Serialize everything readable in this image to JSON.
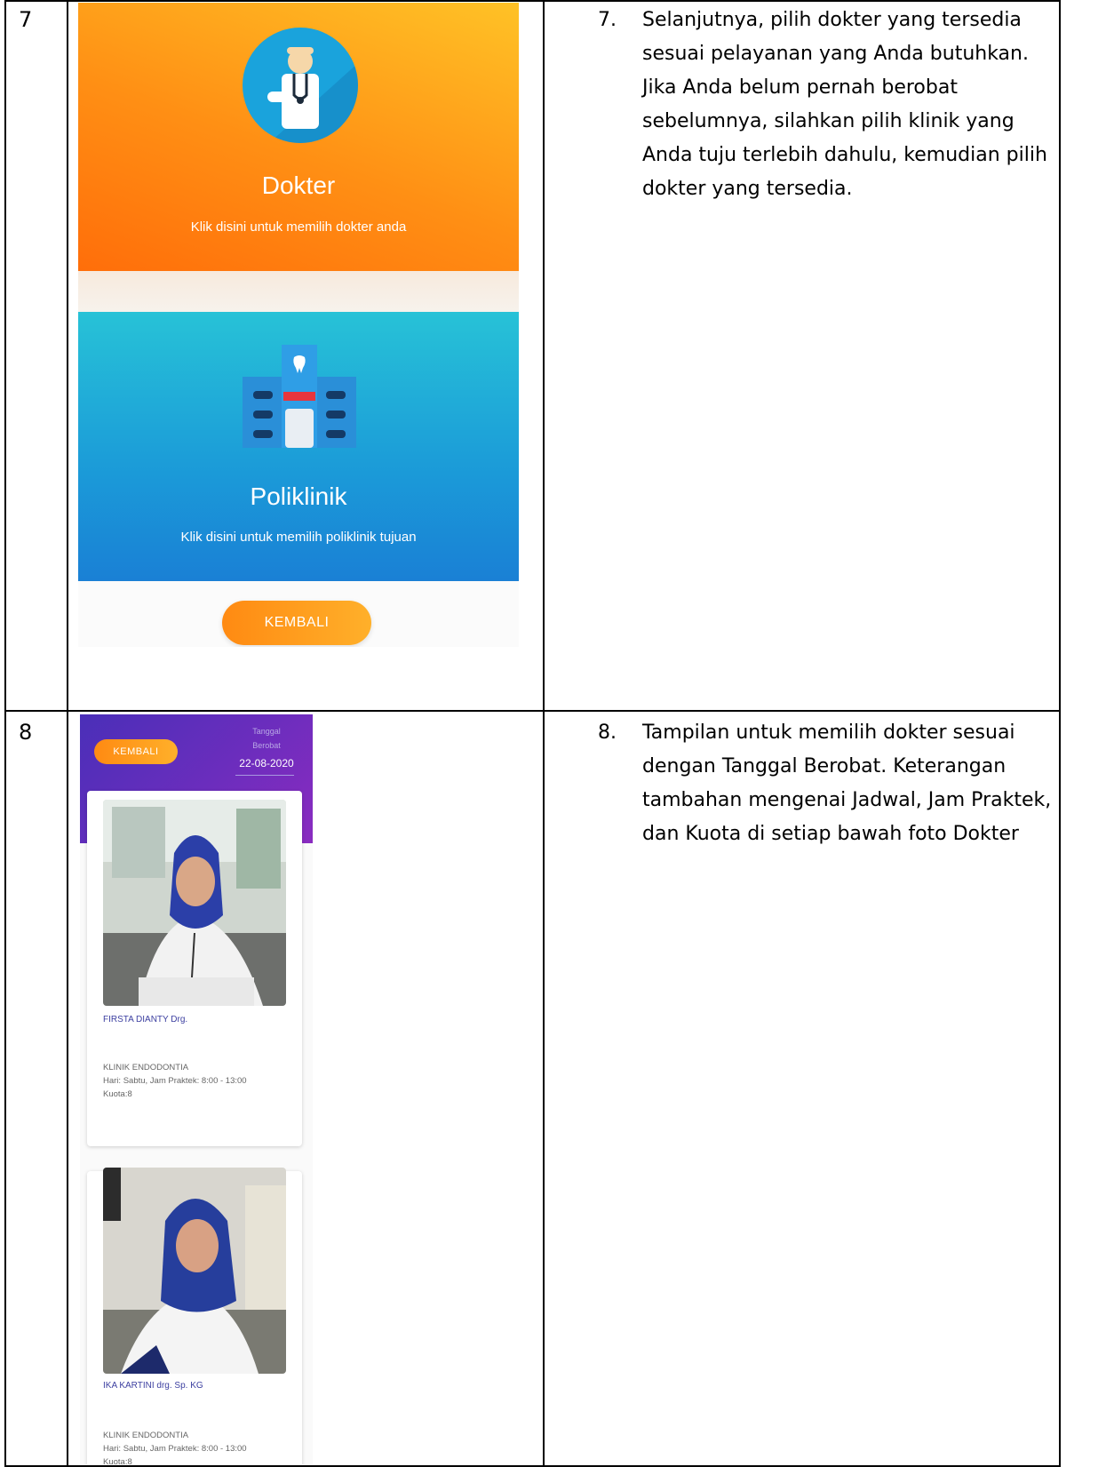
{
  "rows": [
    {
      "number": "7",
      "step_number": "7.",
      "description": "Selanjutnya, pilih dokter yang tersedia sesuai pelayanan yang Anda butuhkan. Jika Anda belum pernah berobat sebelumnya, silahkan pilih klinik yang Anda tuju terlebih dahulu, kemudian pilih dokter yang tersedia.",
      "screen": {
        "dokter_card": {
          "title": "Dokter",
          "subtitle": "Klik disini untuk memilih dokter anda",
          "icon": "doctor-icon"
        },
        "poliklinik_card": {
          "title": "Poliklinik",
          "subtitle": "Klik disini untuk memilih poliklinik tujuan",
          "icon": "hospital-icon"
        },
        "back_button": "KEMBALI",
        "colors": {
          "orange": "#ff8f14",
          "blue": "#1b9ad8"
        }
      }
    },
    {
      "number": "8",
      "step_number": "8.",
      "description": "Tampilan untuk memilih dokter sesuai dengan Tanggal Berobat. Keterangan tambahan mengenai Jadwal, Jam Praktek, dan Kuota di setiap bawah foto Dokter",
      "screen": {
        "back_button": "KEMBALI",
        "date_label_1": "Tanggal",
        "date_label_2": "Berobat",
        "date_value": "22-08-2020",
        "doctors": [
          {
            "name": "FIRSTA DIANTY Drg.",
            "clinic": "KLINIK ENDODONTIA",
            "schedule": "Hari: Sabtu, Jam Praktek: 8:00 - 13:00",
            "quota": "Kuota:8"
          },
          {
            "name": "IKA KARTINI drg. Sp. KG",
            "clinic": "KLINIK ENDODONTIA",
            "schedule": "Hari: Sabtu, Jam Praktek: 8:00 - 13:00",
            "quota": "Kuota:8"
          }
        ],
        "colors": {
          "header": "#6b2dbd",
          "accent": "#ff8a12"
        }
      }
    }
  ]
}
